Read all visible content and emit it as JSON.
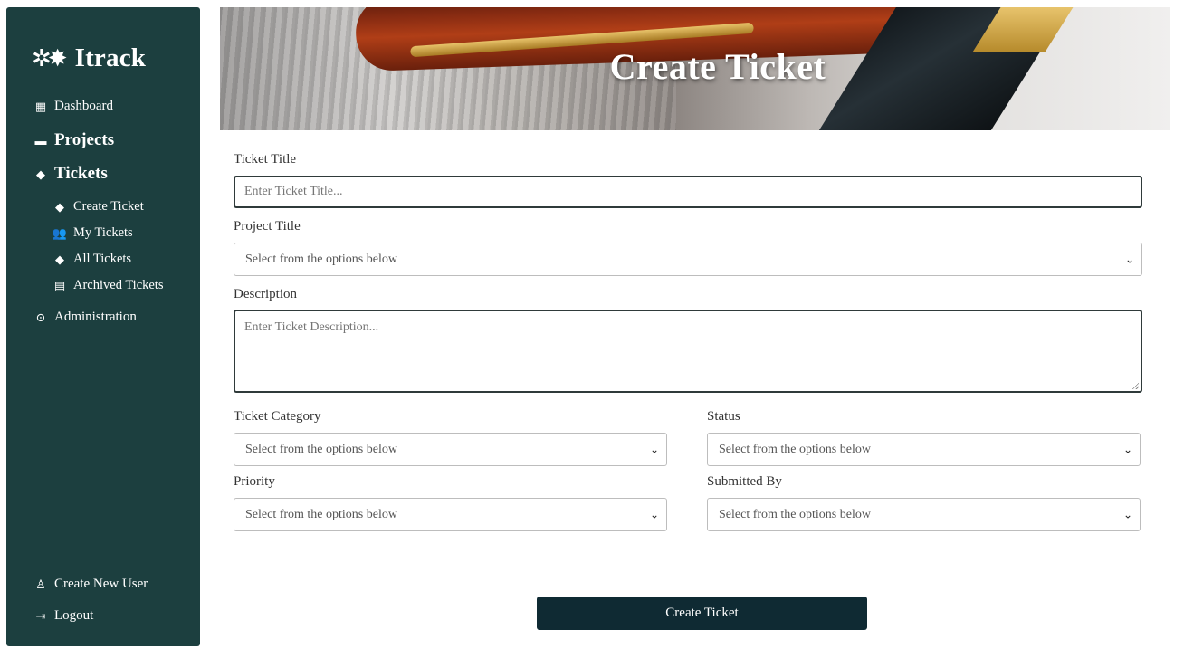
{
  "sidebar": {
    "brand": {
      "logo": "✲✸",
      "name": "Itrack"
    },
    "nav": {
      "dashboard": {
        "icon": "▦",
        "label": "Dashboard"
      },
      "projects": {
        "icon": "▬",
        "label": "Projects"
      },
      "tickets": {
        "icon": "◆",
        "label": "Tickets"
      },
      "create_ticket": {
        "icon": "◆",
        "label": "Create Ticket"
      },
      "my_tickets": {
        "icon": "👥",
        "label": "My Tickets"
      },
      "all_tickets": {
        "icon": "◆",
        "label": "All Tickets"
      },
      "archived_tickets": {
        "icon": "▤",
        "label": "Archived Tickets"
      },
      "administration": {
        "icon": "⊙",
        "label": "Administration"
      }
    },
    "footer": {
      "create_user": {
        "icon": "♙",
        "label": "Create New User"
      },
      "logout": {
        "icon": "⇥",
        "label": "Logout"
      }
    }
  },
  "banner": {
    "title": "Create Ticket"
  },
  "form": {
    "ticket_title": {
      "label": "Ticket Title",
      "placeholder": "Enter Ticket Title..."
    },
    "project_title": {
      "label": "Project Title",
      "value": "Select from the options below"
    },
    "description": {
      "label": "Description",
      "placeholder": "Enter Ticket Description..."
    },
    "ticket_category": {
      "label": "Ticket Category",
      "value": "Select from the options below"
    },
    "status": {
      "label": "Status",
      "value": "Select from the options below"
    },
    "priority": {
      "label": "Priority",
      "value": "Select from the options below"
    },
    "submitted_by": {
      "label": "Submitted By",
      "value": "Select from the options below"
    },
    "submit_label": "Create Ticket"
  },
  "colors": {
    "sidebar_bg": "#1c3f3f",
    "button_bg": "#0f2a33",
    "text": "#333333"
  }
}
